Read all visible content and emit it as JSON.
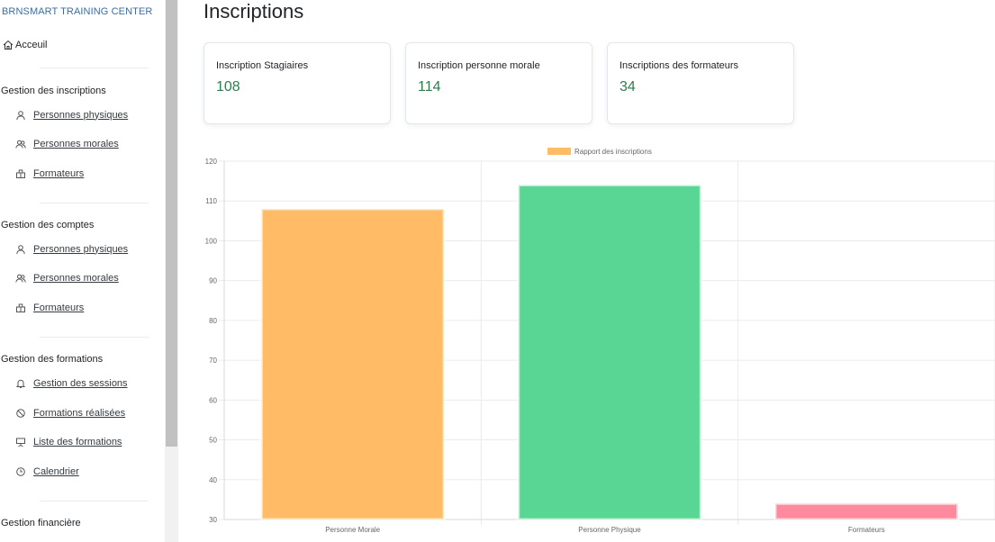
{
  "sidebar": {
    "brand": "BRNSMART TRAINING CENTER",
    "home": "Acceuil",
    "sections": [
      {
        "title": "Gestion des inscriptions",
        "items": [
          {
            "label": "Personnes physiques",
            "icon": "user-icon"
          },
          {
            "label": "Personnes morales",
            "icon": "users-icon"
          },
          {
            "label": "Formateurs",
            "icon": "briefcase-icon"
          }
        ]
      },
      {
        "title": "Gestion des comptes",
        "items": [
          {
            "label": "Personnes physiques",
            "icon": "user-icon"
          },
          {
            "label": "Personnes morales",
            "icon": "users-icon"
          },
          {
            "label": "Formateurs",
            "icon": "briefcase-icon"
          }
        ]
      },
      {
        "title": "Gestion des formations",
        "items": [
          {
            "label": "Gestion des sessions",
            "icon": "bell-icon"
          },
          {
            "label": "Formations réalisées",
            "icon": "badge-icon"
          },
          {
            "label": "Liste des formations",
            "icon": "presentation-icon"
          },
          {
            "label": "Calendrier",
            "icon": "clock-icon"
          }
        ]
      },
      {
        "title": "Gestion financière",
        "items": []
      }
    ]
  },
  "main": {
    "title": "Inscriptions",
    "cards": [
      {
        "title": "Inscription Stagiaires",
        "value": "108"
      },
      {
        "title": "Inscription personne morale",
        "value": "114"
      },
      {
        "title": "Inscriptions des formateurs",
        "value": "34"
      }
    ]
  },
  "chart_data": {
    "type": "bar",
    "categories": [
      "Personne Morale",
      "Personne Physique",
      "Formateurs"
    ],
    "series": [
      {
        "name": "Rapport des inscriptions",
        "values": [
          108,
          114,
          34
        ]
      }
    ],
    "colors": [
      "#ffbb66",
      "#59d693",
      "#ff8a9e"
    ],
    "legend_color": "#ffbb66",
    "ylim": [
      30,
      120
    ],
    "yticks": [
      30,
      40,
      50,
      60,
      70,
      80,
      90,
      100,
      110,
      120
    ],
    "grid": true,
    "legend": "top-center"
  }
}
